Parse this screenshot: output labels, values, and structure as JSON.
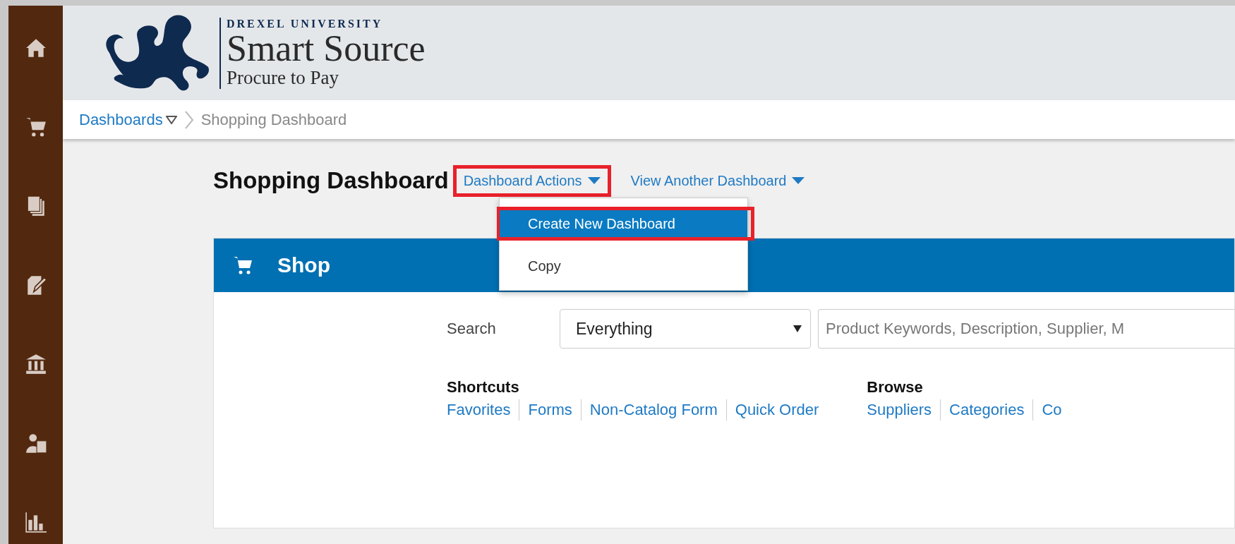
{
  "sidebar": {
    "items": [
      {
        "kind": "home"
      },
      {
        "kind": "cart"
      },
      {
        "kind": "documents"
      },
      {
        "kind": "edit"
      },
      {
        "kind": "bank"
      },
      {
        "kind": "person"
      },
      {
        "kind": "chart"
      }
    ]
  },
  "header": {
    "brand_top": "DREXEL UNIVERSITY",
    "brand_title": "Smart Source",
    "brand_subtitle": "Procure to Pay"
  },
  "breadcrumb": {
    "root": "Dashboards",
    "current": "Shopping Dashboard"
  },
  "page": {
    "title": "Shopping Dashboard",
    "actions": [
      {
        "label": "Dashboard Actions",
        "highlighted": true
      },
      {
        "label": "View Another Dashboard",
        "highlighted": false
      }
    ],
    "menu": [
      {
        "label": "Create New Dashboard",
        "selected": true,
        "highlighted": true
      },
      {
        "label": "Copy",
        "selected": false,
        "highlighted": false
      }
    ]
  },
  "shop": {
    "title": "Shop",
    "search_label": "Search",
    "scope": "Everything",
    "placeholder": "Product Keywords, Description, Supplier, M",
    "groups": [
      {
        "title": "Shortcuts",
        "links": [
          "Favorites",
          "Forms",
          "Non-Catalog Form",
          "Quick Order"
        ]
      },
      {
        "title": "Browse",
        "links": [
          "Suppliers",
          "Categories",
          "Co"
        ]
      }
    ]
  }
}
